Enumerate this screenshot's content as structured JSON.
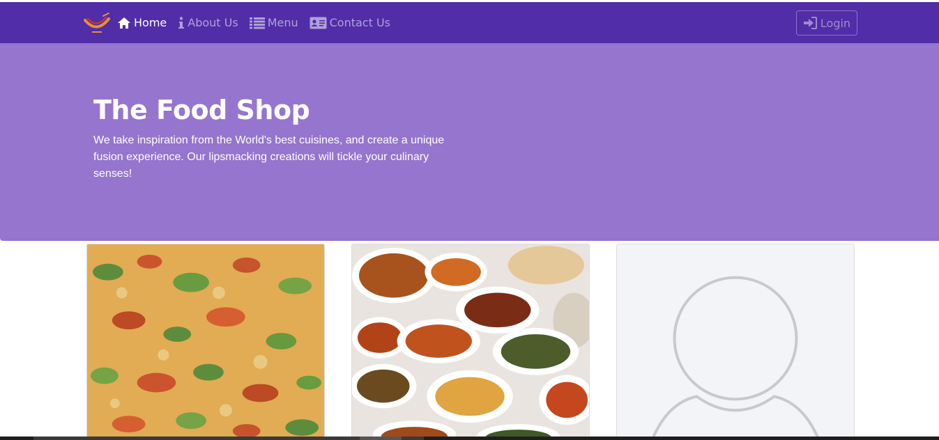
{
  "navbar": {
    "logo_icon": "restaurant-logo-icon",
    "background": "#512da8",
    "items": [
      {
        "label": "Home",
        "icon": "home-icon",
        "active": true
      },
      {
        "label": "About Us",
        "icon": "info-icon",
        "active": false
      },
      {
        "label": "Menu",
        "icon": "list-icon",
        "active": false
      },
      {
        "label": "Contact Us",
        "icon": "address-card-icon",
        "active": false
      }
    ],
    "login": {
      "label": "Login",
      "icon": "sign-in-icon"
    }
  },
  "jumbotron": {
    "title": "The Food Shop",
    "description": "We take inspiration from the World's best cuisines, and create a unique fusion experience. Our lipsmacking creations will tickle your culinary senses!",
    "background": "#9575cd"
  },
  "cards": [
    {
      "image": "pizza-image"
    },
    {
      "image": "buffet-dishes-image"
    },
    {
      "image": "avatar-placeholder-image"
    }
  ]
}
